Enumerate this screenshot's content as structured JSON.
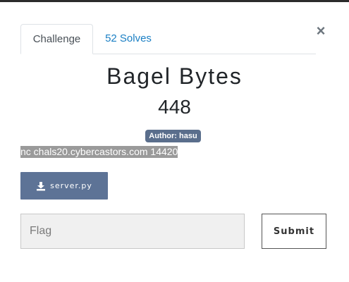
{
  "modal": {
    "close_label": "×",
    "tabs": [
      {
        "label": "Challenge",
        "active": true
      },
      {
        "label": "52 Solves",
        "active": false
      }
    ],
    "challenge": {
      "title": "Bagel Bytes",
      "points": "448",
      "author": "Author: hasu",
      "connection": "nc chals20.cybercastors.com 14420",
      "file_label": "server.py",
      "file_icon": "download-icon"
    },
    "flag_form": {
      "placeholder": "Flag",
      "value": "",
      "submit_label": "Submit"
    }
  },
  "colors": {
    "badge": "#5a6e8c",
    "file_button": "#5d7396",
    "tab_link": "#1a7fc4",
    "selection_highlight": "#9a9a9a"
  }
}
